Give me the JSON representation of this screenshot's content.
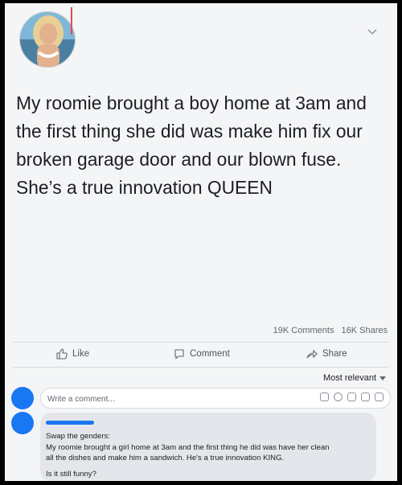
{
  "post": {
    "text": "My roomie brought a boy home at 3am and the first thing she did was make him fix our broken garage door and our blown fuse. She’s a true innovation QUEEN",
    "comments_count": "19K Comments",
    "shares_count": "16K Shares"
  },
  "actions": {
    "like": "Like",
    "comment": "Comment",
    "share": "Share"
  },
  "sort": {
    "label": "Most relevant"
  },
  "composer": {
    "placeholder": "Write a comment..."
  },
  "comment": {
    "line1": "Swap the genders:",
    "line2": "My roomie brought a girl home at 3am and the first thing he did was have her clean",
    "line3": "all the dishes and make him a sandwich. He's a true innovation KING.",
    "line4": "Is it still funny?"
  },
  "colors": {
    "accent": "#1877f2",
    "background": "#f4f5f6",
    "bubble": "#e4e6eb"
  },
  "icons": [
    "chevron-down-icon",
    "like-icon",
    "comment-icon",
    "share-icon",
    "emoji-icons"
  ]
}
